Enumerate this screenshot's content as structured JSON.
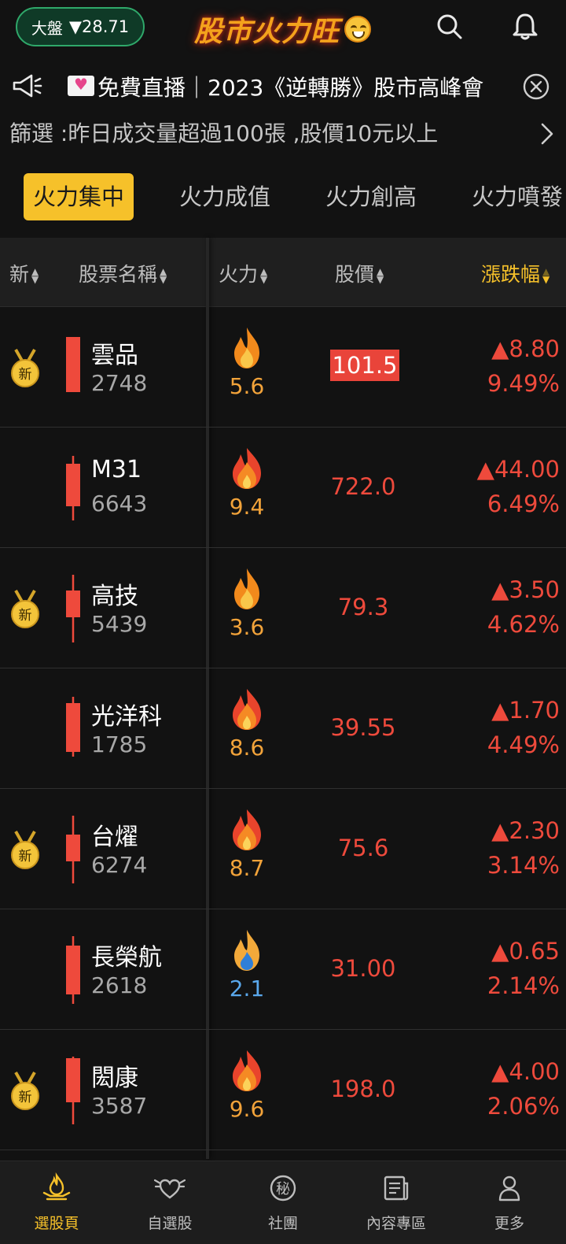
{
  "header": {
    "index_label": "大盤",
    "index_value": "▼28.71",
    "brand": "股市火力旺",
    "search_icon": "search-icon",
    "bell_icon": "bell-icon"
  },
  "announcement": {
    "text": "免費直播｜2023《逆轉勝》股市高峰會"
  },
  "filter": {
    "text": "篩選 :昨日成交量超過100張 ,股價10元以上"
  },
  "tabs": [
    {
      "label": "火力集中"
    },
    {
      "label": "火力成值"
    },
    {
      "label": "火力創高"
    },
    {
      "label": "火力噴發"
    }
  ],
  "table": {
    "headers": {
      "new": "新",
      "name": "股票名稱",
      "fire": "火力",
      "price": "股價",
      "change": "漲跌幅"
    },
    "new_badge_label": "新",
    "rows": [
      {
        "name": "雲品",
        "code": "2748",
        "fire": "5.6",
        "price": "101.5",
        "change": "▲8.80",
        "pct": "9.49%"
      },
      {
        "name": "M31",
        "code": "6643",
        "fire": "9.4",
        "price": "722.0",
        "change": "▲44.00",
        "pct": "6.49%"
      },
      {
        "name": "高技",
        "code": "5439",
        "fire": "3.6",
        "price": "79.3",
        "change": "▲3.50",
        "pct": "4.62%"
      },
      {
        "name": "光洋科",
        "code": "1785",
        "fire": "8.6",
        "price": "39.55",
        "change": "▲1.70",
        "pct": "4.49%"
      },
      {
        "name": "台燿",
        "code": "6274",
        "fire": "8.7",
        "price": "75.6",
        "change": "▲2.30",
        "pct": "3.14%"
      },
      {
        "name": "長榮航",
        "code": "2618",
        "fire": "2.1",
        "price": "31.00",
        "change": "▲0.65",
        "pct": "2.14%"
      },
      {
        "name": "閎康",
        "code": "3587",
        "fire": "9.6",
        "price": "198.0",
        "change": "▲4.00",
        "pct": "2.06%"
      }
    ]
  },
  "nav": [
    {
      "label": "選股頁"
    },
    {
      "label": "自選股"
    },
    {
      "label": "社團"
    },
    {
      "label": "內容專區"
    },
    {
      "label": "更多"
    }
  ],
  "colors": {
    "accent": "#f6c12a",
    "up": "#ee4a3c",
    "index_pill": "#2fa86a"
  }
}
